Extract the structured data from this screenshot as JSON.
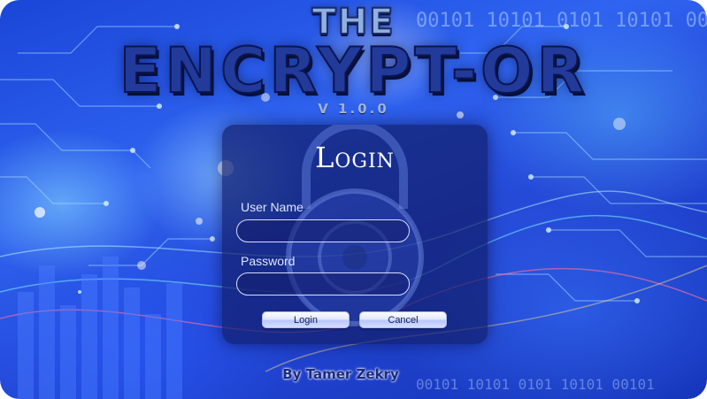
{
  "app": {
    "title_line1": "THE",
    "title_line2": "ENCRYPT-OR",
    "version": "V 1.0.0",
    "byline": "By Tamer Zekry"
  },
  "login": {
    "heading": "Login",
    "username_label": "User Name",
    "username_value": "",
    "password_label": "Password",
    "password_value": "",
    "login_button": "Login",
    "cancel_button": "Cancel"
  },
  "background": {
    "binary_text": "00101 10101 0101 10101 00101",
    "icon": "lock-icon"
  },
  "colors": {
    "background_blue": "#2f63f0",
    "panel": "#121e6e",
    "title_dark_blue": "#223a9a"
  }
}
